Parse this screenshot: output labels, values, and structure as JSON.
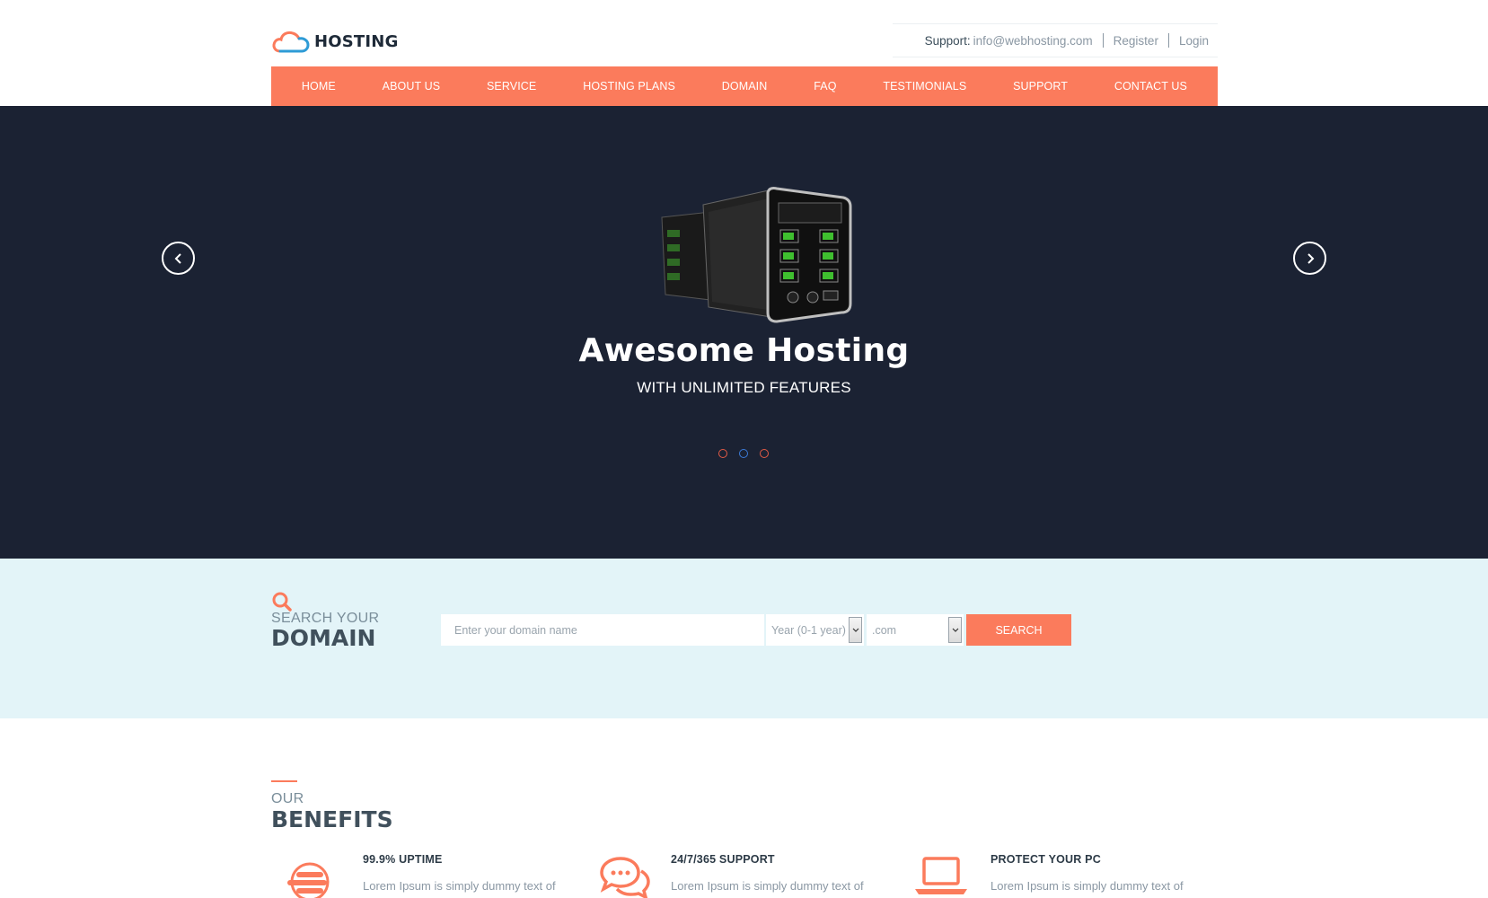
{
  "brand": {
    "logo_text": "HOSTING"
  },
  "top_links": {
    "support_label": "Support:",
    "support_email": "info@webhosting.com",
    "register": "Register",
    "login": "Login"
  },
  "nav": {
    "items": [
      {
        "label": "HOME"
      },
      {
        "label": "ABOUT US"
      },
      {
        "label": "SERVICE"
      },
      {
        "label": "HOSTING PLANS"
      },
      {
        "label": "DOMAIN"
      },
      {
        "label": "FAQ"
      },
      {
        "label": "TESTIMONIALS"
      },
      {
        "label": "SUPPORT"
      },
      {
        "label": "CONTACT US"
      }
    ]
  },
  "hero": {
    "title": "Awesome Hosting",
    "subtitle": "WITH UNLIMITED FEATURES",
    "active_slide": 2,
    "slide_count": 3
  },
  "domain_search": {
    "small_title": "SEARCH YOUR",
    "big_title": "DOMAIN",
    "input_placeholder": "Enter your domain name",
    "year_selected": "Year (0-1 year)",
    "tld_selected": ".com",
    "button_label": "SEARCH"
  },
  "benefits": {
    "small_title": "OUR",
    "big_title": "BENEFITS",
    "items": [
      {
        "title": "99.9% UPTIME",
        "text": "Lorem Ipsum is simply dummy text of",
        "icon": "uptime-icon"
      },
      {
        "title": "24/7/365 SUPPORT",
        "text": "Lorem Ipsum is simply dummy text of the",
        "icon": "chat-icon"
      },
      {
        "title": "PROTECT YOUR PC",
        "text": "Lorem Ipsum is simply dummy text of the",
        "icon": "laptop-icon"
      }
    ]
  },
  "colors": {
    "accent": "#fb7b5c",
    "hero_bg": "#1b2233",
    "domain_bg": "#e3f4f8",
    "heading": "#40505c"
  }
}
